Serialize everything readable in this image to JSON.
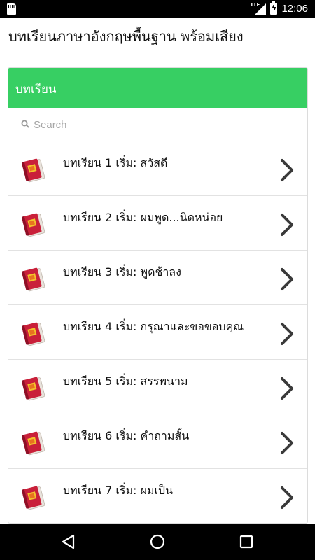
{
  "status_bar": {
    "network_label": "LTE",
    "time": "12:06",
    "icons": [
      "sd-card-icon",
      "signal-icon",
      "battery-charging-icon"
    ]
  },
  "app_bar": {
    "title": "บทเรียนภาษาอังกฤษพื้นฐาน พร้อมเสียง"
  },
  "panel": {
    "header": "บทเรียน",
    "header_color": "#37cf63",
    "search_placeholder": "Search"
  },
  "lessons": [
    {
      "label": "บทเรียน 1 เริ่ม: สวัสดี",
      "icon": "book-icon"
    },
    {
      "label": "บทเรียน 2 เริ่ม: ผมพูด...นิดหน่อย",
      "icon": "book-icon"
    },
    {
      "label": "บทเรียน 3 เริ่ม: พูดช้าลง",
      "icon": "book-icon"
    },
    {
      "label": "บทเรียน 4 เริ่ม: กรุณาและขอขอบคุณ",
      "icon": "book-icon"
    },
    {
      "label": "บทเรียน 5 เริ่ม: สรรพนาม",
      "icon": "book-icon"
    },
    {
      "label": "บทเรียน 6 เริ่ม: คำถามสั้น",
      "icon": "book-icon"
    },
    {
      "label": "บทเรียน 7 เริ่ม: ผมเป็น",
      "icon": "book-icon"
    }
  ],
  "nav_bar": {
    "buttons": [
      "back-icon",
      "home-icon",
      "recents-icon"
    ]
  }
}
